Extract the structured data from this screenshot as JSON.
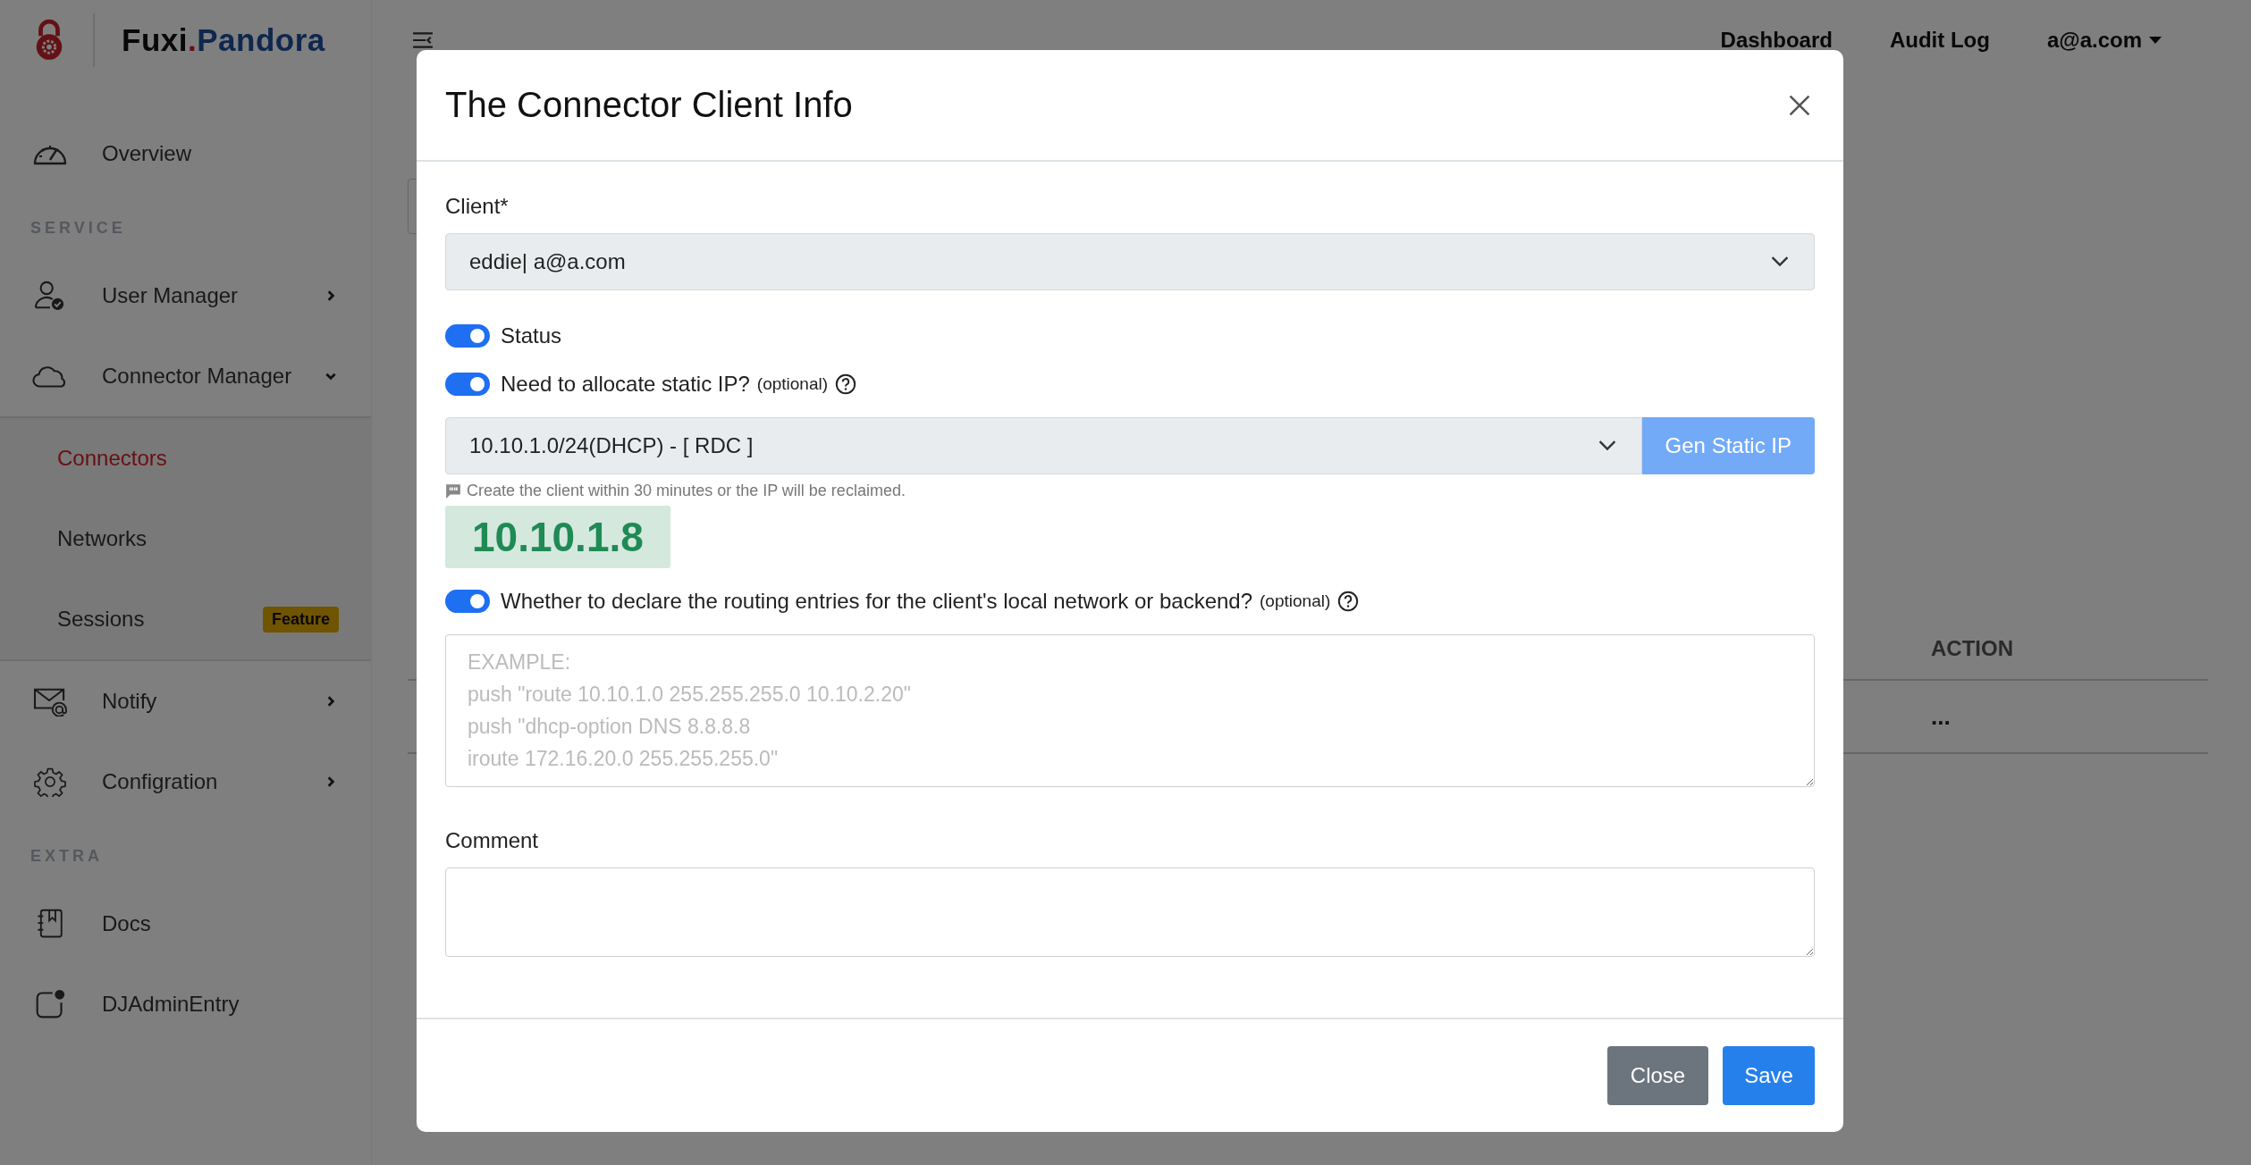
{
  "brand": {
    "parts": [
      "Fuxi",
      ".",
      "Pandora"
    ]
  },
  "topnav": [
    {
      "label": "Dashboard"
    },
    {
      "label": "Audit Log"
    }
  ],
  "user_menu": {
    "label": "a@a.com"
  },
  "sidebar": {
    "items": [
      {
        "kind": "item",
        "label": "Overview"
      },
      {
        "kind": "section",
        "label": "SERVICE"
      },
      {
        "kind": "item",
        "label": "User Manager",
        "expanded": false
      },
      {
        "kind": "item",
        "label": "Connector Manager",
        "expanded": true,
        "children": [
          {
            "label": "Connectors",
            "selected": true
          },
          {
            "label": "Networks",
            "selected": false
          },
          {
            "label": "Sessions",
            "selected": false,
            "badge": "Feature"
          }
        ]
      },
      {
        "kind": "item",
        "label": "Notify",
        "expanded": false
      },
      {
        "kind": "item",
        "label": "Configration",
        "expanded": false
      },
      {
        "kind": "section",
        "label": "EXTRA"
      },
      {
        "kind": "item",
        "label": "Docs"
      },
      {
        "kind": "item",
        "label": "DJAdminEntry"
      }
    ]
  },
  "background_page": {
    "table": {
      "columns": [
        "ACTION"
      ],
      "rows": [
        [
          "..."
        ]
      ]
    }
  },
  "modal": {
    "title": "The Connector Client Info",
    "client": {
      "label": "Client*",
      "value": "eddie| a@a.com"
    },
    "toggles": [
      {
        "label": "Status",
        "on": true
      }
    ],
    "static_ip": {
      "label": "Need to allocate static IP?",
      "hint": "(optional)",
      "on": true,
      "network": "10.10.1.0/24(DHCP) - [ RDC ]",
      "button": {
        "label": "Gen Static IP",
        "disabled": true
      },
      "note": "Create the client within 30 minutes or the IP will be reclaimed.",
      "ip": "10.10.1.8"
    },
    "routing": {
      "label": "Whether to declare the routing entries for the client's local network or backend?",
      "hint": "(optional)",
      "on": true,
      "placeholder": "EXAMPLE:\npush \"route 10.10.1.0 255.255.255.0 10.10.2.20\"\npush \"dhcp-option DNS 8.8.8.8\niroute 172.16.20.0 255.255.255.0\""
    },
    "comment": {
      "label": "Comment"
    },
    "buttons": [
      {
        "label": "Close",
        "kind": "secondary"
      },
      {
        "label": "Save",
        "kind": "primary"
      }
    ]
  }
}
